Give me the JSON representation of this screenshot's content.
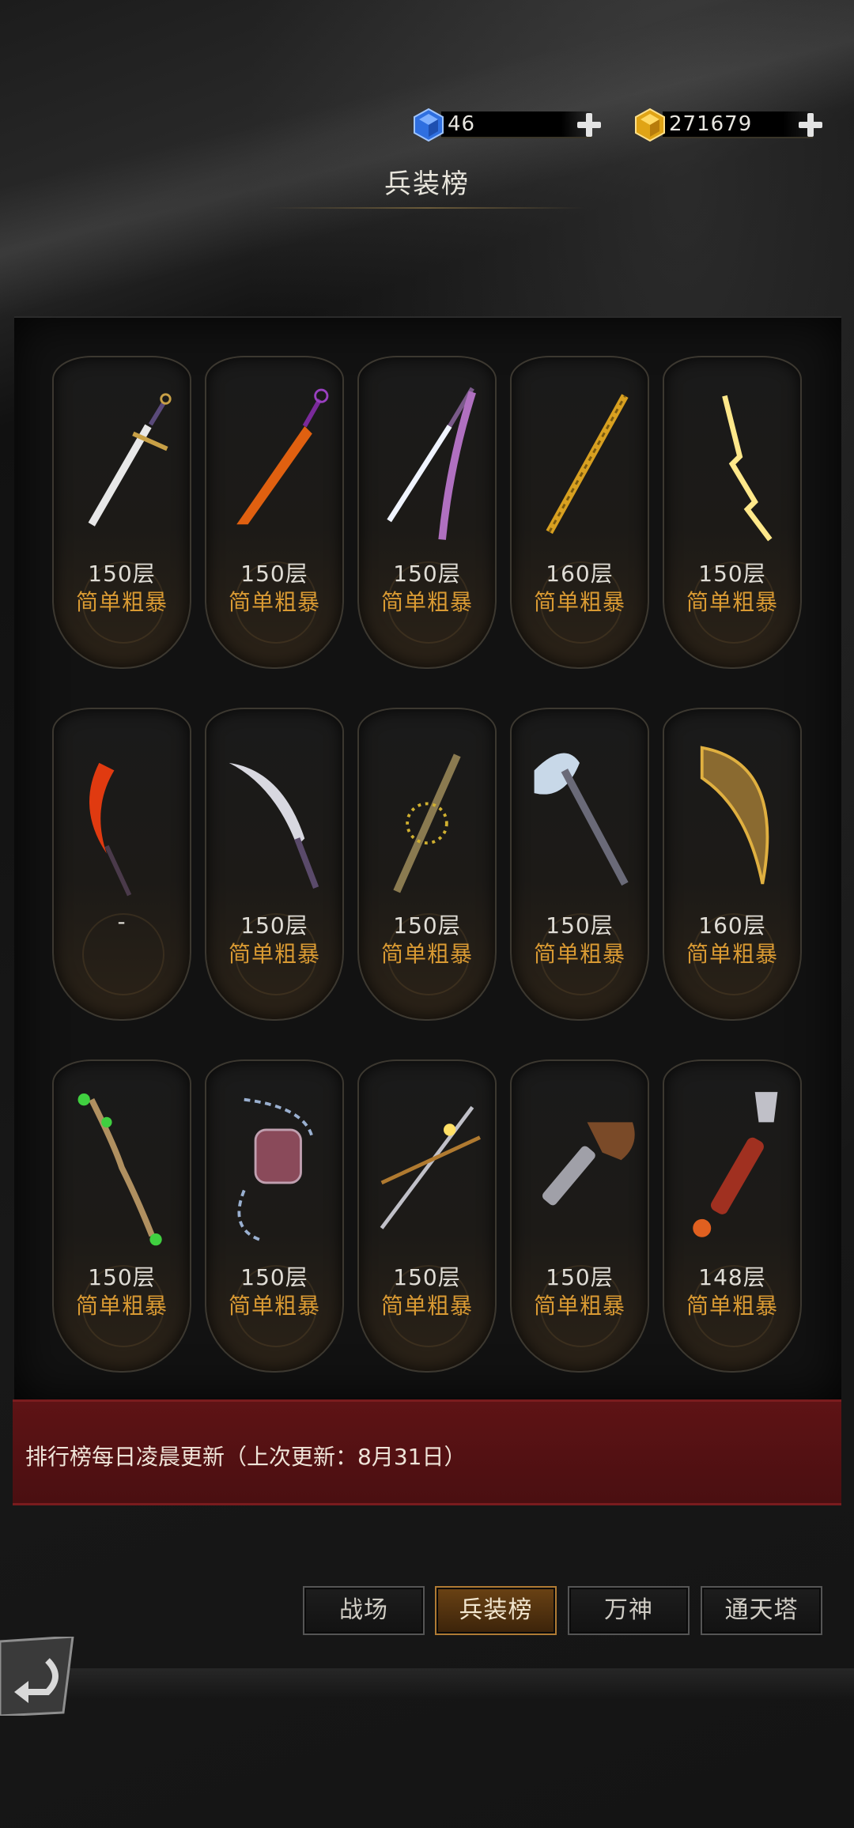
{
  "header": {
    "diamond_value": "46",
    "gold_value": "271679",
    "title": "兵装榜"
  },
  "cards": [
    {
      "level": "150层",
      "type": "简单粗暴",
      "icon": "sword-icon"
    },
    {
      "level": "150层",
      "type": "简单粗暴",
      "icon": "flame-blade-icon"
    },
    {
      "level": "150层",
      "type": "简单粗暴",
      "icon": "katana-icon"
    },
    {
      "level": "160层",
      "type": "简单粗暴",
      "icon": "golden-spear-icon"
    },
    {
      "level": "150层",
      "type": "简单粗暴",
      "icon": "lightning-blade-icon"
    },
    {
      "level": "-",
      "type": "",
      "icon": "fire-scythe-icon"
    },
    {
      "level": "150层",
      "type": "简单粗暴",
      "icon": "curved-dagger-icon"
    },
    {
      "level": "150层",
      "type": "简单粗暴",
      "icon": "thorned-spear-icon"
    },
    {
      "level": "150层",
      "type": "简单粗暴",
      "icon": "battle-axe-icon"
    },
    {
      "level": "160层",
      "type": "简单粗暴",
      "icon": "horn-icon"
    },
    {
      "level": "150层",
      "type": "简单粗暴",
      "icon": "branch-staff-icon"
    },
    {
      "level": "150层",
      "type": "简单粗暴",
      "icon": "chain-gauntlet-icon"
    },
    {
      "level": "150层",
      "type": "简单粗暴",
      "icon": "spear-staff-icon"
    },
    {
      "level": "150层",
      "type": "简单粗暴",
      "icon": "flintlock-pistol-icon"
    },
    {
      "level": "148层",
      "type": "简单粗暴",
      "icon": "axe-pistol-icon"
    }
  ],
  "notice": "排行榜每日凌晨更新（上次更新：8月31日）",
  "tabs": [
    "战场",
    "兵装榜",
    "万神",
    "通天塔"
  ],
  "active_tab": "兵装榜",
  "colors": {
    "accent": "#d99a33",
    "notice_bg": "#5e1315",
    "active_tab": "#6a4214"
  }
}
